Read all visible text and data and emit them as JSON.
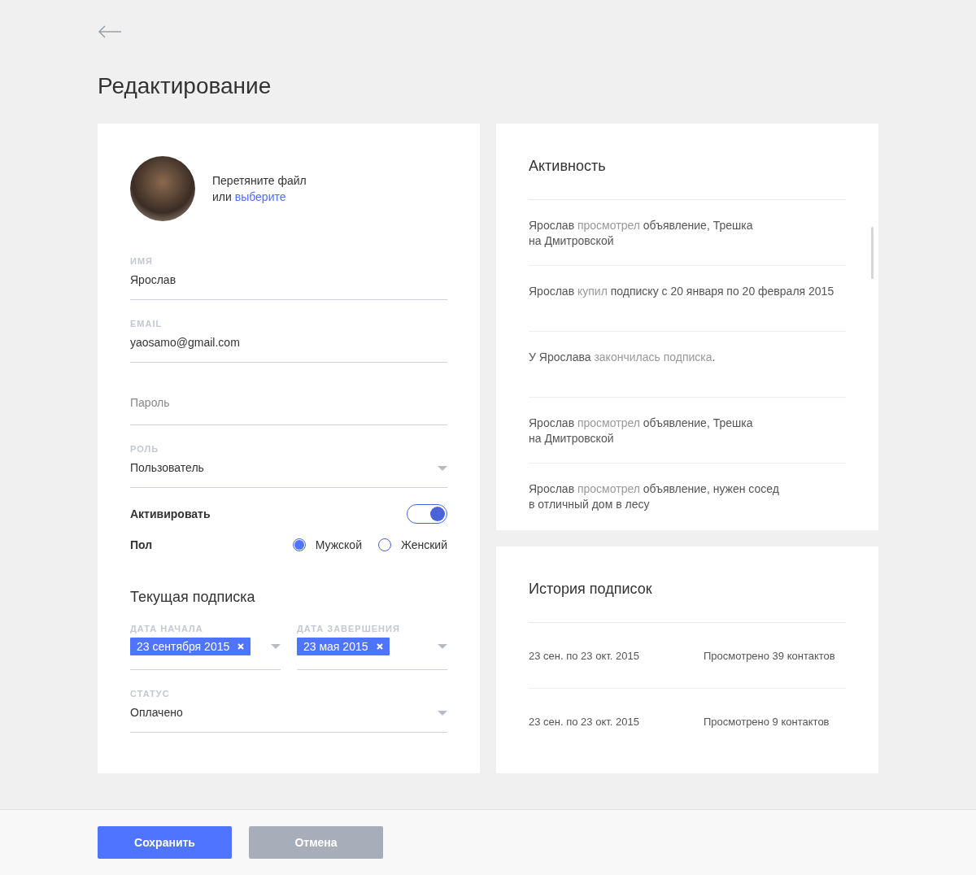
{
  "page": {
    "title": "Редактирование"
  },
  "profile": {
    "upload": {
      "line1": "Перетяните файл",
      "prefix": "или",
      "link": "выберите"
    },
    "fields": [
      {
        "kind": "text",
        "label": "ИМЯ",
        "value": "Ярослав"
      },
      {
        "kind": "text",
        "label": "EMAIL",
        "value": "yaosamo@gmail.com"
      },
      {
        "kind": "password",
        "placeholder": "Пароль"
      },
      {
        "kind": "select",
        "label": "РОЛЬ",
        "value": "Пользователь"
      }
    ],
    "activate": {
      "label": "Активировать",
      "on": true
    },
    "gender": {
      "label": "Пол",
      "options": [
        {
          "label": "Мужской",
          "selected": true
        },
        {
          "label": "Женский",
          "selected": false
        }
      ]
    },
    "subscription": {
      "title": "Текущая подписка",
      "dates": [
        {
          "label": "ДАТА НАЧАЛА",
          "value": "23 сентября 2015"
        },
        {
          "label": "ДАТА ЗАВЕРШЕНИЯ",
          "value": "23 мая 2015"
        }
      ],
      "status": {
        "label": "СТАТУС",
        "value": "Оплачено"
      }
    }
  },
  "activity": {
    "title": "Активность",
    "items": [
      {
        "parts": [
          {
            "kind": "plain",
            "text": "Ярослав"
          },
          {
            "kind": "muted",
            "text": "просмотрел"
          },
          {
            "kind": "plain",
            "text": "объявление, Трешка\nна Дмитровской"
          }
        ]
      },
      {
        "parts": [
          {
            "kind": "plain",
            "text": "Ярослав"
          },
          {
            "kind": "muted",
            "text": "купил"
          },
          {
            "kind": "plain",
            "text": "подписку с 20 января по 20 февраля 2015"
          }
        ]
      },
      {
        "parts": [
          {
            "kind": "plain",
            "text": "У Ярослава"
          },
          {
            "kind": "muted",
            "text": "закончилась подписка"
          },
          {
            "kind": "tail",
            "text": "."
          }
        ]
      },
      {
        "parts": [
          {
            "kind": "plain",
            "text": "Ярослав"
          },
          {
            "kind": "muted",
            "text": "просмотрел"
          },
          {
            "kind": "plain",
            "text": "объявление, Трешка\nна Дмитровской"
          }
        ]
      },
      {
        "parts": [
          {
            "kind": "plain",
            "text": "Ярослав"
          },
          {
            "kind": "muted",
            "text": "просмотрел"
          },
          {
            "kind": "plain",
            "text": "объявление, нужен сосед\nв отличный дом в лесу"
          }
        ]
      }
    ]
  },
  "history": {
    "title": "История подписок",
    "rows": [
      {
        "period": "23 сен. по 23 окт. 2015",
        "views": "Просмотрено 39 контактов"
      },
      {
        "period": "23 сен. по 23 окт. 2015",
        "views": "Просмотрено 9 контактов"
      }
    ]
  },
  "footer": {
    "buttons": [
      {
        "kind": "primary",
        "label": "Сохранить"
      },
      {
        "kind": "secondary",
        "label": "Отмена"
      }
    ]
  }
}
